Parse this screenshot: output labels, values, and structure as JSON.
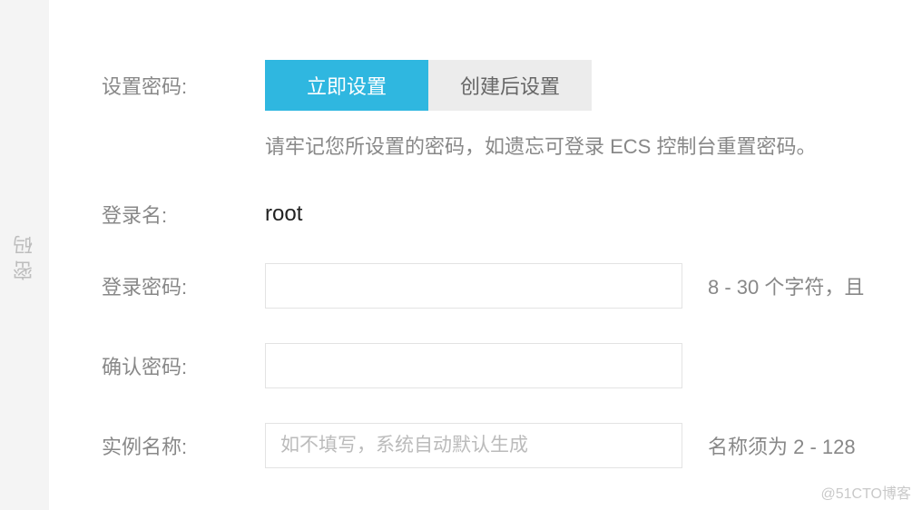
{
  "rail": {
    "label": "密码"
  },
  "rows": {
    "set_password_label": "设置密码:",
    "login_name_label": "登录名:",
    "login_password_label": "登录密码:",
    "confirm_password_label": "确认密码:",
    "instance_name_label": "实例名称:"
  },
  "tabs": {
    "now": "立即设置",
    "later": "创建后设置"
  },
  "hints": {
    "remember": "请牢记您所设置的密码，如遗忘可登录 ECS 控制台重置密码。",
    "password_rule": "8 - 30 个字符，且",
    "name_rule": "名称须为 2 - 128"
  },
  "values": {
    "login_name": "root",
    "instance_name_placeholder": "如不填写，系统自动默认生成"
  },
  "watermark": "@51CTO博客"
}
